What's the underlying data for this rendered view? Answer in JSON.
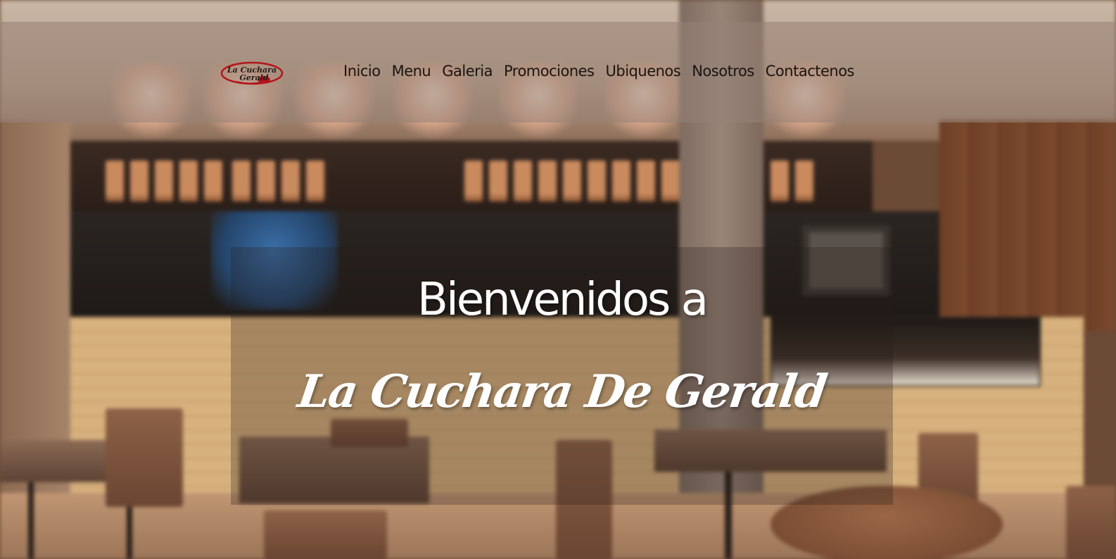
{
  "header": {
    "logo": {
      "name": "logo-la-cuchara-de-gerald",
      "text_line1": "La Cuchara",
      "text_line2": "Gerald",
      "accent_color": "#b3151b"
    },
    "nav": [
      {
        "label": "Inicio"
      },
      {
        "label": "Menu"
      },
      {
        "label": "Galeria"
      },
      {
        "label": "Promociones"
      },
      {
        "label": "Ubiquenos"
      },
      {
        "label": "Nosotros"
      },
      {
        "label": "Contactenos"
      }
    ]
  },
  "hero": {
    "line1": "Bienvenidos a",
    "line2": "La Cuchara De Gerald"
  },
  "colors": {
    "header_overlay": "#96827699",
    "nav_text": "#1a1410",
    "hero_text": "#ffffff"
  }
}
